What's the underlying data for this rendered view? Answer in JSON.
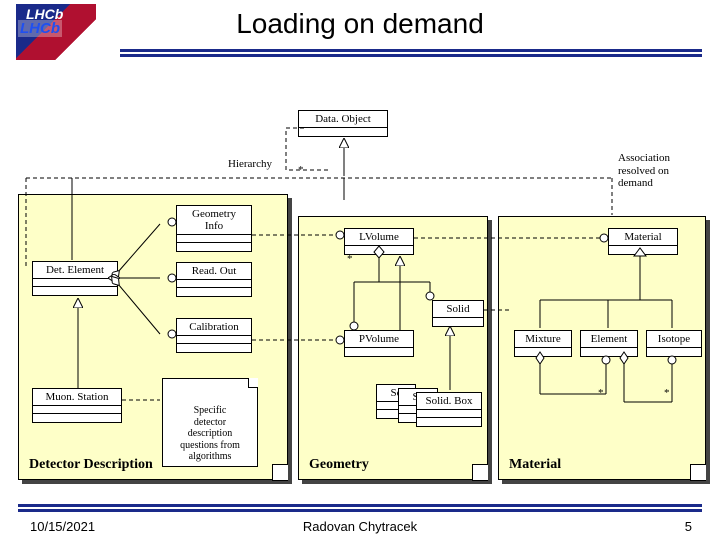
{
  "title": "Loading on demand",
  "logo_line1": "LHCb",
  "logo_line2": "LHCb",
  "hierarchy_label": "Hierarchy",
  "assoc_label": "Association\nresolved on\ndemand",
  "boxes": {
    "dataobject": "Data. Object",
    "geometryinfo": "Geometry\nInfo",
    "readout": "Read. Out",
    "calibration": "Calibration",
    "detelement": "Det. Element",
    "muonstation": "Muon. Station",
    "lvolume": "LVolume",
    "pvolume": "PVolume",
    "solid": "Solid",
    "solidbox": "Solid. Box",
    "solid_sc1": "Sc",
    "solid_sc2": "Sc",
    "material": "Material",
    "mixture": "Mixture",
    "element": "Element",
    "isotope": "Isotope"
  },
  "specific_note": "Specific\ndetector\ndescription\nquestions from\nalgorithms",
  "panels": {
    "detdesc": "Detector Description",
    "geometry": "Geometry",
    "material": "Material"
  },
  "ast1": "*",
  "ast2": "*",
  "ast3": "*",
  "ast4": "*",
  "footer": {
    "date": "10/15/2021",
    "author": "Radovan Chytracek",
    "page": "5"
  }
}
